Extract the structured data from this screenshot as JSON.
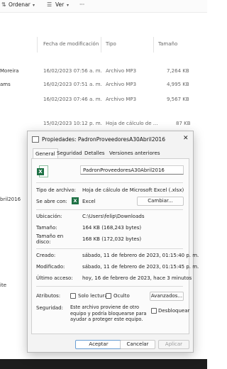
{
  "toolbar": {
    "sort_label": "Ordenar",
    "view_label": "Ver",
    "more": "···"
  },
  "columns": {
    "modified": "Fecha de modificación",
    "type": "Tipo",
    "size": "Tamaño"
  },
  "rows": [
    {
      "name": "Moreira",
      "modified": "16/02/2023 07:56 a. m.",
      "type": "Archivo MP3",
      "size": "7,264 KB"
    },
    {
      "name": "ams",
      "modified": "16/02/2023 07:51 a. m.",
      "type": "Archivo MP3",
      "size": "4,995 KB"
    },
    {
      "name": "",
      "modified": "16/02/2023 07:46 a. m.",
      "type": "Archivo MP3",
      "size": "9,567 KB"
    },
    {
      "name": "",
      "modified": "15/02/2023 10:12 p. m.",
      "type": "Hoja de cálculo de ...",
      "size": "87 KB"
    }
  ],
  "left_cut": {
    "item_selected": "bril2016",
    "item_bottom": "ite"
  },
  "dialog": {
    "title": "Propiedades: PadronProveedoresA30Abril2016",
    "close_glyph": "✕",
    "tabs": [
      "General",
      "Seguridad",
      "Detalles",
      "Versiones anteriores"
    ],
    "file_name": "PadronProveedoresA30Abril2016",
    "labels": {
      "file_type": "Tipo de archivo:",
      "opens_with": "Se abre con:",
      "location": "Ubicación:",
      "size": "Tamaño:",
      "size_on_disk_1": "Tamaño en",
      "size_on_disk_2": "disco:",
      "created": "Creado:",
      "modified": "Modificado:",
      "accessed": "Último acceso:",
      "attributes": "Atributos:",
      "security": "Seguridad:"
    },
    "values": {
      "file_type": "Hoja de cálculo de Microsoft Excel (.xlsx)",
      "opens_with": "Excel",
      "location": "C:\\Users\\felip\\Downloads",
      "size": "164 KB (168,243 bytes)",
      "size_on_disk": "168 KB (172,032 bytes)",
      "created": "sábado, 11 de febrero de 2023, 01:15:40 p. m.",
      "modified": "sábado, 11 de febrero de 2023, 01:15:45 p. m.",
      "accessed": "hoy, 16 de febrero de 2023, hace 3 minutos",
      "security_text": "Este archivo proviene de otro equipo y podría bloquearse para ayudar a proteger este equipo."
    },
    "buttons": {
      "change": "Cambiar...",
      "advanced": "Avanzados...",
      "accept": "Aceptar",
      "cancel": "Cancelar",
      "apply": "Aplicar"
    },
    "checkboxes": {
      "read_only": "Solo lectura",
      "hidden": "Oculto",
      "unblock": "Desbloquear"
    }
  }
}
